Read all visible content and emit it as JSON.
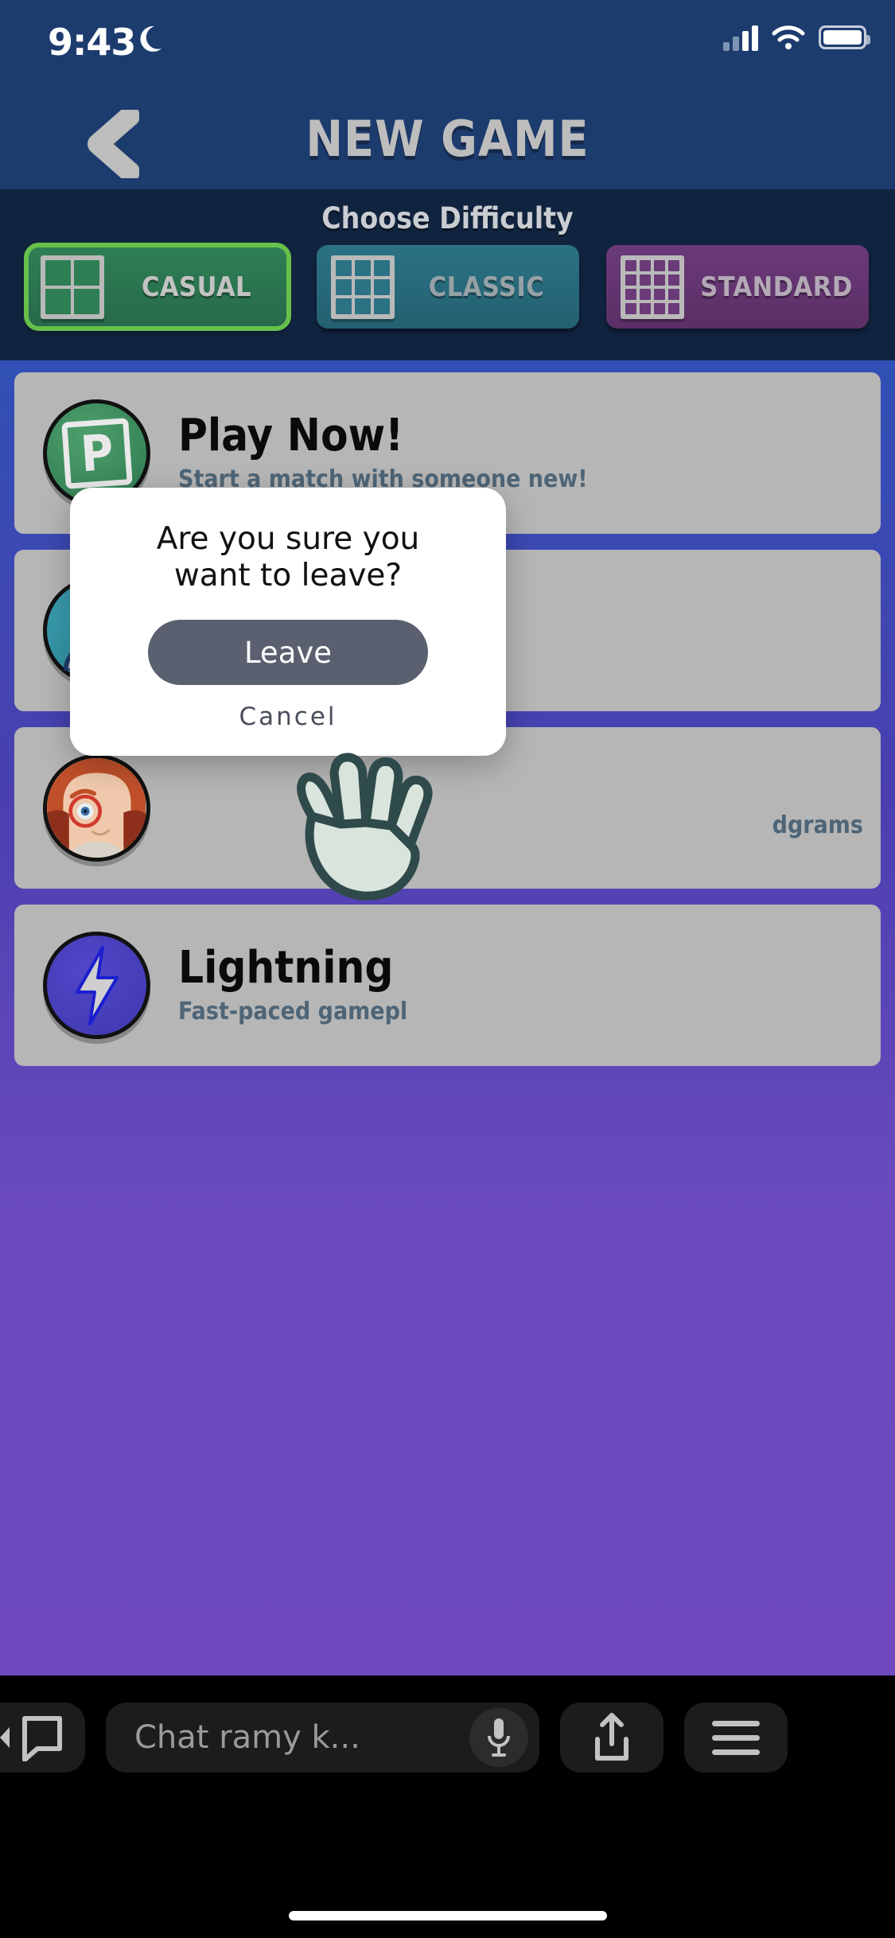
{
  "status_bar": {
    "time": "9:43",
    "dnd_icon": "moon-icon",
    "signal_icon": "cellular-signal-icon",
    "wifi_icon": "wifi-icon",
    "battery_icon": "battery-icon"
  },
  "header": {
    "back_icon": "back-chevron-icon",
    "title": "NEW GAME"
  },
  "difficulty": {
    "label": "Choose Difficulty",
    "selected": "CASUAL",
    "options": [
      {
        "label": "CASUAL",
        "grid": "2x2",
        "color": "#2f7f55",
        "icon": "grid-2x2-icon",
        "selected": true
      },
      {
        "label": "CLASSIC",
        "grid": "3x3",
        "color": "#2b7284",
        "icon": "grid-3x3-icon",
        "selected": false
      },
      {
        "label": "STANDARD",
        "grid": "4x4",
        "color": "#6b3a79",
        "icon": "grid-4x4-icon",
        "selected": false
      }
    ]
  },
  "modes": [
    {
      "title": "Play Now!",
      "subtitle": "Start a match with someone new!",
      "icon": "p-badge-icon",
      "avatar_color": "#2e7a50"
    },
    {
      "title": "",
      "subtitle": "",
      "icon": "person-icon",
      "avatar_color": "#2d8b9c"
    },
    {
      "title": "",
      "subtitle": "dgrams",
      "icon": "character-portrait-icon",
      "avatar_color": "#d8cdc0"
    },
    {
      "title": "Lightning",
      "subtitle": "Fast-paced gamepl",
      "icon": "lightning-bolt-icon",
      "avatar_color": "#3f37ae"
    }
  ],
  "modal": {
    "message": "Are you sure you want to leave?",
    "primary_label": "Leave",
    "cancel_label": "Cancel",
    "primary_color": "#5a6070"
  },
  "cursor": {
    "icon": "pointing-hand-cursor"
  },
  "bottom_bar": {
    "back_icon": "back-to-app-icon",
    "chat_placeholder": "Chat ramy k...",
    "mic_icon": "microphone-icon",
    "share_icon": "share-upload-icon",
    "menu_icon": "hamburger-menu-icon",
    "home_indicator": "home-indicator"
  }
}
